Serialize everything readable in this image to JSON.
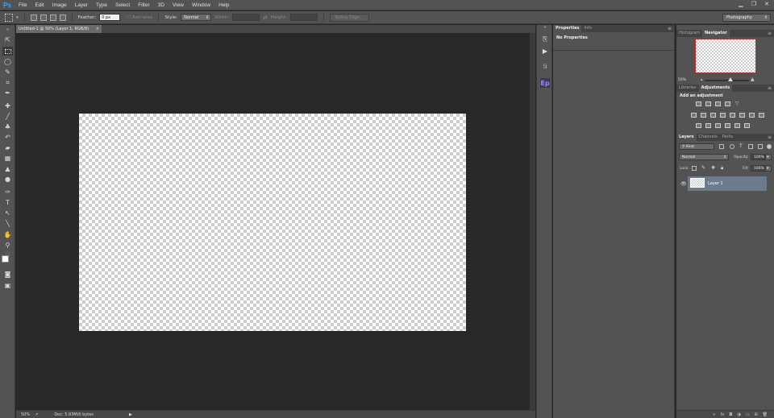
{
  "app": {
    "logo": "Ps"
  },
  "menu": [
    "File",
    "Edit",
    "Image",
    "Layer",
    "Type",
    "Select",
    "Filter",
    "3D",
    "View",
    "Window",
    "Help"
  ],
  "window_controls": {
    "minimize": "▁",
    "restore": "❐",
    "close": "✕"
  },
  "options": {
    "feather_label": "Feather:",
    "feather_value": "0 px",
    "antialias_label": "Anti-alias",
    "style_label": "Style:",
    "style_value": "Normal",
    "width_label": "Width:",
    "height_label": "Height:",
    "refine_edge": "Refine Edge..."
  },
  "workspace": "Photography",
  "document": {
    "tab_title": "Untitled-1 @ 50% (Layer 1, RGB/8)",
    "tab_close": "×",
    "zoom": "50%",
    "doc_info": "Doc: 5.93M/0 bytes"
  },
  "properties_panel": {
    "tabs": [
      "Properties",
      "Info"
    ],
    "message": "No Properties"
  },
  "navigator_panel": {
    "tabs": [
      "Histogram",
      "Navigator"
    ],
    "zoom": "50%"
  },
  "adjustments_panel": {
    "tabs": [
      "Libraries",
      "Adjustments"
    ],
    "title": "Add an adjustment"
  },
  "layers_panel": {
    "tabs": [
      "Layers",
      "Channels",
      "Paths"
    ],
    "filter_kind": "Kind",
    "blend_mode": "Normal",
    "opacity_label": "Opacity:",
    "opacity_value": "100%",
    "lock_label": "Lock:",
    "fill_label": "Fill:",
    "fill_value": "100%",
    "layers": [
      {
        "name": "Layer 1"
      }
    ],
    "footer_icons": [
      "link-icon",
      "fx-icon",
      "mask-icon",
      "adjustment-icon",
      "folder-icon",
      "new-layer-icon",
      "trash-icon"
    ],
    "footer_glyphs": [
      "∞",
      "fx",
      "◘",
      "◑",
      "▭",
      "⊞",
      "🗑"
    ]
  },
  "colors": {
    "accent_blue": "#31a8ff",
    "selected_layer": "#6c7a8e",
    "nav_frame": "#e02020",
    "panel_bg": "#535353",
    "pasteboard": "#282828"
  }
}
